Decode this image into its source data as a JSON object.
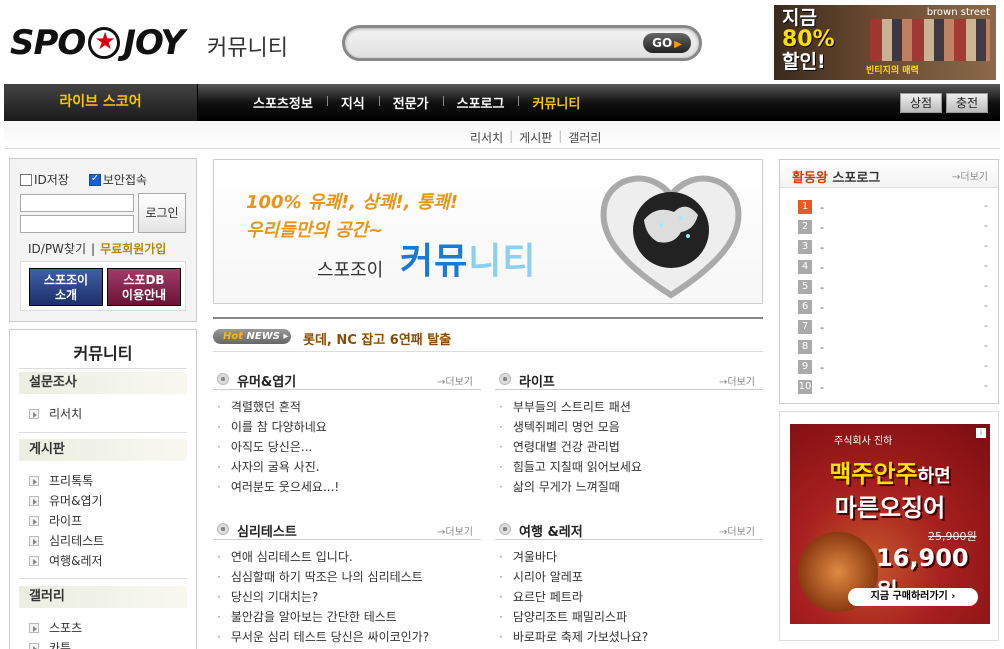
{
  "header": {
    "logo_left": "SPO",
    "logo_right": "JOY",
    "site_section": "커뮤니티",
    "search_placeholder": "",
    "search_button": "GO",
    "ad": {
      "line1": "지금",
      "line2": "80%",
      "line3": "할인!",
      "brand": "brown street",
      "tag": "빈티지의 매력"
    }
  },
  "nav": {
    "live_score": "라이브 스코어",
    "items": [
      "스포츠정보",
      "지식",
      "전문가",
      "스포로그",
      "커뮤니티"
    ],
    "right_buttons": [
      "상점",
      "충전"
    ],
    "sub_items": [
      "리서치",
      "게시판",
      "갤러리"
    ]
  },
  "login": {
    "save_id": "ID저장",
    "secure": "보안접속",
    "login_button": "로그인",
    "find": "ID/PW찾기",
    "join": "무료회원가입",
    "promo_left_1": "스포조이",
    "promo_left_2": "소개",
    "promo_right_1": "스포DB",
    "promo_right_2": "이용안내"
  },
  "community": {
    "title": "커뮤니티",
    "survey_head": "설문조사",
    "survey_items": [
      "리서치"
    ],
    "board_head": "게시판",
    "board_items": [
      "프리톡톡",
      "유머&엽기",
      "라이프",
      "심리테스트",
      "여행&레저"
    ],
    "gallery_head": "갤러리",
    "gallery_items": [
      "스포츠",
      "카툰"
    ]
  },
  "banner": {
    "line1": "100% 유쾌!, 상쾌!, 통쾌!",
    "line2": "우리들만의 공간~",
    "sub": "스포조이",
    "big_1": "커뮤",
    "big_2": "니티"
  },
  "hotnews": {
    "badge_hot": "Hot",
    "badge_news": "NEWS",
    "text": "롯데, NC 잡고 6연패 탈출"
  },
  "boards": {
    "more": "→더보기",
    "humor": {
      "title": "유머&엽기",
      "items": [
        "격렬했던 흔적",
        "이를 참 다양하네요",
        "아직도 당신은...",
        "사자의 굴욕 사진.",
        "여러분도 웃으세요...!"
      ]
    },
    "life": {
      "title": "라이프",
      "items": [
        "부부들의 스트리트 패션",
        "생텍쥐페리 명언 모음",
        "연령대별 건강 관리법",
        "힘들고 지칠때 읽어보세요",
        "삶의 무게가 느껴질때"
      ]
    },
    "psych": {
      "title": "심리테스트",
      "items": [
        "연애 심리테스트 입니다.",
        "심심할때 하기 딱조은 나의 심리테스트",
        "당신의 기대치는?",
        "불안감을 알아보는 간단한 테스트",
        "무서운 심리 테스트 당신은 싸이코인가?"
      ]
    },
    "travel": {
      "title": "여행 &레저",
      "items": [
        "겨울바다",
        "시리아 알레포",
        "요르단 페트라",
        "담양리조트 패밀리스파",
        "바로파로 축제 가보셨나요?"
      ]
    }
  },
  "ranking": {
    "title_accent": "활동왕",
    "title": "스포로그",
    "more": "→더보기",
    "rows": [
      {
        "num": "1",
        "name": "-",
        "value": "-"
      },
      {
        "num": "2",
        "name": "-",
        "value": "-"
      },
      {
        "num": "3",
        "name": "-",
        "value": "-"
      },
      {
        "num": "4",
        "name": "-",
        "value": "-"
      },
      {
        "num": "5",
        "name": "-",
        "value": "-"
      },
      {
        "num": "6",
        "name": "-",
        "value": "-"
      },
      {
        "num": "7",
        "name": "-",
        "value": "-"
      },
      {
        "num": "8",
        "name": "-",
        "value": "-"
      },
      {
        "num": "9",
        "name": "-",
        "value": "-"
      },
      {
        "num": "10",
        "name": "-",
        "value": "-"
      }
    ]
  },
  "side_ad": {
    "brand": "주식회사 진하",
    "line1_a": "맥주안주",
    "line1_b": "하면",
    "line2": "마른오징어",
    "old_price": "25,900원",
    "new_price": "16,900원",
    "cta": "지금 구매하러가기 ›"
  },
  "colors": {
    "accent_gold": "#f6c600",
    "hot_text": "#8a4b00",
    "rank_first": "#e85a1f"
  }
}
